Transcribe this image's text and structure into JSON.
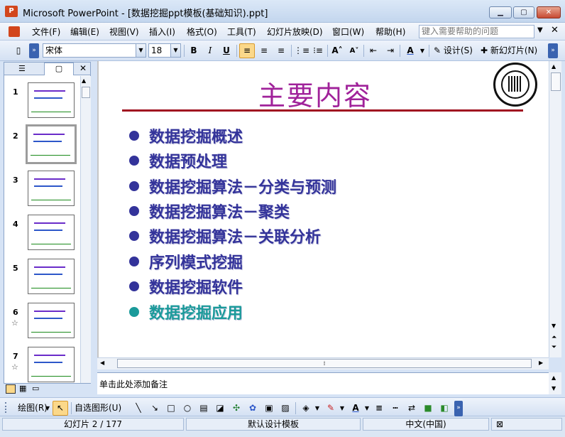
{
  "window": {
    "title": "Microsoft PowerPoint - [数据挖掘ppt模板(基础知识).ppt]",
    "app_icon_letter": "P"
  },
  "menu": {
    "items": [
      "文件(F)",
      "编辑(E)",
      "视图(V)",
      "插入(I)",
      "格式(O)",
      "工具(T)",
      "幻灯片放映(D)",
      "窗口(W)",
      "帮助(H)"
    ],
    "help_placeholder": "键入需要帮助的问题"
  },
  "toolbar": {
    "font_name": "宋体",
    "font_size": "18",
    "bold": "B",
    "italic": "I",
    "underline": "U",
    "design_label": "设计(S)",
    "new_slide_label": "新幻灯片(N)"
  },
  "slides_panel": {
    "thumbnails": [
      {
        "number": "1",
        "has_star": false
      },
      {
        "number": "2",
        "has_star": false,
        "selected": true
      },
      {
        "number": "3",
        "has_star": false
      },
      {
        "number": "4",
        "has_star": false
      },
      {
        "number": "5",
        "has_star": false
      },
      {
        "number": "6",
        "has_star": true
      },
      {
        "number": "7",
        "has_star": true
      }
    ],
    "star_glyph": "☆"
  },
  "slide": {
    "title": "主要内容",
    "title_color": "#a0229a",
    "bullets": [
      {
        "text": "数据挖掘概述",
        "color": "#33339a"
      },
      {
        "text": "数据预处理",
        "color": "#33339a"
      },
      {
        "text": "数据挖掘算法－分类与预测",
        "color": "#33339a"
      },
      {
        "text": "数据挖掘算法－聚类",
        "color": "#33339a"
      },
      {
        "text": "数据挖掘算法－关联分析",
        "color": "#33339a"
      },
      {
        "text": "序列模式挖掘",
        "color": "#33339a"
      },
      {
        "text": "数据挖掘软件",
        "color": "#33339a"
      },
      {
        "text": "数据挖掘应用",
        "color": "#1a9a9a"
      }
    ]
  },
  "notes": {
    "placeholder": "单击此处添加备注"
  },
  "drawing_toolbar": {
    "draw_label": "绘图(R)",
    "autoshapes_label": "自选图形(U)"
  },
  "status": {
    "slide_position": "幻灯片 2 / 177",
    "template": "默认设计模板",
    "language": "中文(中国)"
  }
}
